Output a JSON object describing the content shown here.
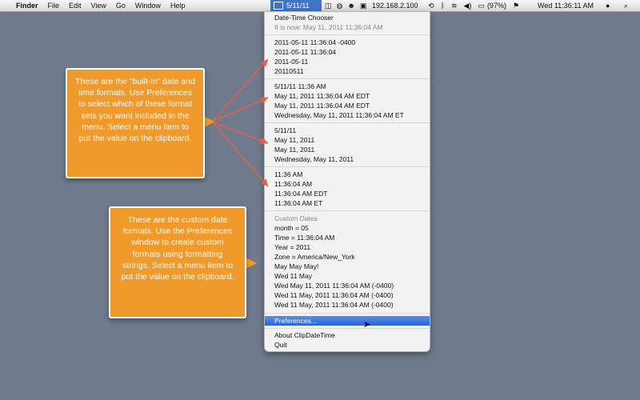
{
  "menubar": {
    "app_name": "Finder",
    "items": [
      "File",
      "Edit",
      "View",
      "Go",
      "Window",
      "Help"
    ],
    "status_clip": "5/11/11",
    "ip_address": "192.168.2.100",
    "battery": "(97%)",
    "clock": "Wed 11:36:11 AM"
  },
  "menu": {
    "title": "Date-Time Chooser",
    "now": "It is now: May 11, 2011 11:36:04 AM",
    "group1": [
      "2011-05-11 11:36:04 -0400",
      "2011-05-11 11:36:04",
      "2011-05-11",
      "20110511"
    ],
    "group2": [
      "5/11/11 11:36 AM",
      "May 11, 2011 11:36:04 AM EDT",
      "May 11, 2011 11:36:04 AM EDT",
      "Wednesday, May 11, 2011 11:36:04 AM ET"
    ],
    "group3": [
      "5/11/11",
      "May 11, 2011",
      "May 11, 2011",
      "Wednesday, May 11, 2011"
    ],
    "group4": [
      "11:36 AM",
      "11:36:04 AM",
      "11:36:04 AM EDT",
      "11:36:04 AM ET"
    ],
    "custom_header": "Custom Dates",
    "custom": [
      "month = 05",
      "Time = 11:36:04 AM",
      "Year = 2011",
      "Zone = America/New_York",
      "May May May!",
      "Wed 11 May",
      "Wed May 11, 2011 11:36:04 AM (-0400)",
      "Wed 11 May, 2011 11:36:04 AM (-0400)",
      "Wed 11 May, 2011 11:36:04 AM (-0400)"
    ],
    "preferences": "Preferences...",
    "about": "About ClipDateTime",
    "quit": "Quit"
  },
  "callouts": {
    "builtin": "These are the \"built-in\" date and time formats. Use Preferences to select which of these format sets you want included in the menu. Select a menu item to put the value on the clipboard.",
    "custom": "These are the custom date formats. Use the Preferences window to create custom formats using formatting strings. Select a menu item to put the value on the clipboard."
  }
}
